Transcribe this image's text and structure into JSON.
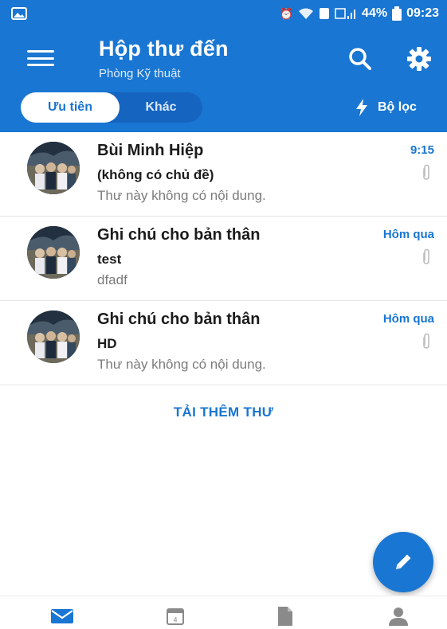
{
  "status_bar": {
    "battery": "44%",
    "time": "09:23",
    "icons": [
      "image-icon",
      "alarm-icon",
      "wifi-icon",
      "sim-icon",
      "signal-icon",
      "battery-icon"
    ]
  },
  "header": {
    "title": "Hộp thư đến",
    "subtitle": "Phòng Kỹ thuật",
    "tabs": {
      "focused": "Ưu tiên",
      "other": "Khác"
    },
    "filter_label": "Bộ lọc"
  },
  "messages": [
    {
      "sender": "Bùi Minh Hiệp",
      "subject": "(không có chủ đề)",
      "preview": "Thư này không có nội dung.",
      "time": "9:15"
    },
    {
      "sender": "Ghi chú cho bản thân",
      "subject": "test",
      "preview": "dfadf",
      "time": "Hôm qua"
    },
    {
      "sender": "Ghi chú cho bản thân",
      "subject": "HD",
      "preview": "Thư này không có nội dung.",
      "time": "Hôm qua"
    }
  ],
  "load_more": "TẢI THÊM THƯ",
  "calendar_day": "4",
  "colors": {
    "accent": "#1976d2",
    "header_bg": "#1976d2",
    "preview_text": "#7b7b7b"
  }
}
